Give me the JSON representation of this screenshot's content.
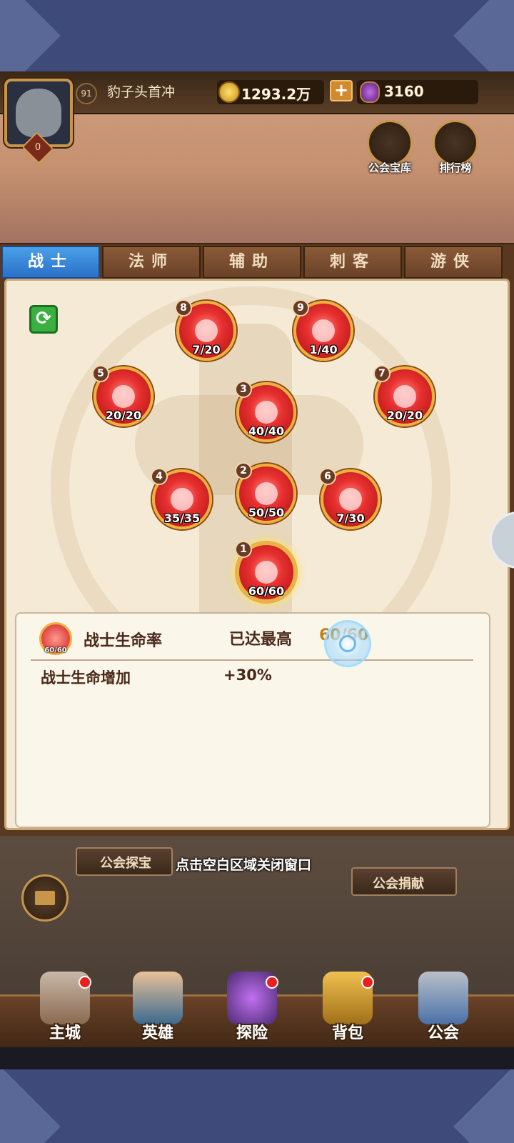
{
  "hud": {
    "level": "91",
    "player_name": "豹子头首冲",
    "vip": "0",
    "gold": "1293.2万",
    "gems": "3160",
    "add_label": "+"
  },
  "top_buttons": [
    {
      "label": "公会宝库",
      "icon": "treasure-chest-icon"
    },
    {
      "label": "排行榜",
      "icon": "ranking-icon"
    }
  ],
  "tabs": [
    {
      "label": "战士",
      "active": true
    },
    {
      "label": "法师",
      "active": false
    },
    {
      "label": "辅助",
      "active": false
    },
    {
      "label": "刺客",
      "active": false
    },
    {
      "label": "游侠",
      "active": false
    }
  ],
  "skill_nodes": [
    {
      "num": "8",
      "count": "7/20"
    },
    {
      "num": "9",
      "count": "1/40"
    },
    {
      "num": "5",
      "count": "20/20"
    },
    {
      "num": "3",
      "count": "40/40"
    },
    {
      "num": "7",
      "count": "20/20"
    },
    {
      "num": "4",
      "count": "35/35"
    },
    {
      "num": "2",
      "count": "50/50"
    },
    {
      "num": "6",
      "count": "7/30"
    },
    {
      "num": "1",
      "count": "60/60"
    }
  ],
  "detail": {
    "icon_count": "60/60",
    "name": "战士生命率",
    "status": "已达最高",
    "count": "60/60",
    "attribute": "战士生命增加",
    "value": "+30%"
  },
  "lower": {
    "left_label": "公会探宝",
    "right_label": "公会捐献",
    "close_hint": "点击空白区域关闭窗口"
  },
  "nav": [
    {
      "label": "主城",
      "badge": true
    },
    {
      "label": "英雄",
      "badge": false
    },
    {
      "label": "探险",
      "badge": true
    },
    {
      "label": "背包",
      "badge": true
    },
    {
      "label": "公会",
      "badge": false
    }
  ],
  "colors": {
    "accent_tab": "#2a70c8",
    "node_red": "#e83030",
    "gold_border": "#f0b040",
    "max_count": "#c08018"
  }
}
